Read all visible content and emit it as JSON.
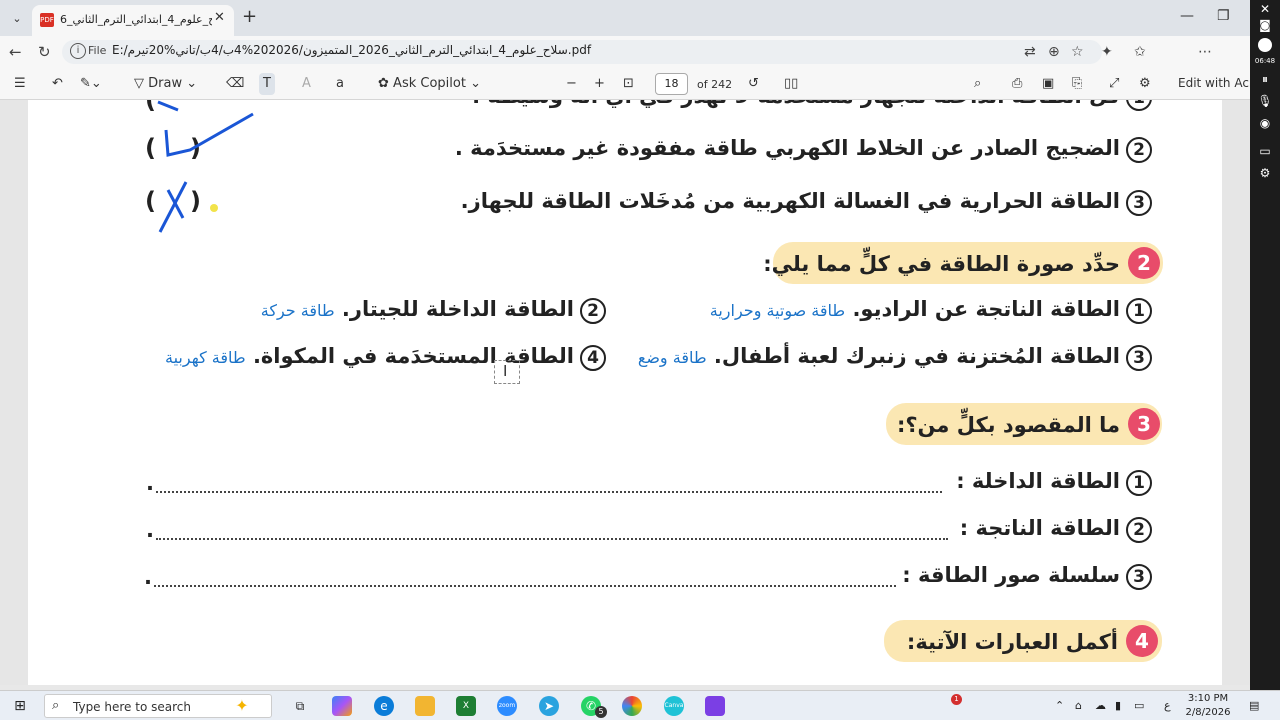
{
  "browser": {
    "tab_title": "6_سلاح_علوم_4_ابتدائي_الترم_الثاني*",
    "tab_icon": "PDF",
    "url_prefix": "File",
    "url": "E:/سلاح_علوم_4_ابتدائي_الترم_الثاني_2026_المتميزون/202026%4ب/4ب/تاني%20تيرم.pdf"
  },
  "pdf_toolbar": {
    "draw_label": "Draw",
    "ask_copilot_label": "Ask Copilot",
    "page_number": "18",
    "page_count": "of 242",
    "edit_label": "Edit with Acro"
  },
  "doc": {
    "q1_item1_partial": "كل الطاقة الداخلة للجهاز مستخدمة لا تهدر في أي آلة وسيطة .",
    "q1_item2": "الضجيج الصادر عن الخلاط الكهربي طاقة مفقودة غير مستخدَمة .",
    "q1_item3": "الطاقة الحرارية في الغسالة الكهربية من مُدخَلات الطاقة للجهاز.",
    "num1": "1",
    "num2": "2",
    "num3": "3",
    "num4": "4",
    "paren_open": "(",
    "paren_close": ")",
    "section2_badge": "2",
    "section2_title": "حدِّد صورة الطاقة في كلٍّ مما يلي:",
    "s2_item1": "الطاقة الناتجة عن الراديو.",
    "s2_item1_answer": "طاقة صوتية وحرارية",
    "s2_item2": "الطاقة الداخلة للجيتار.",
    "s2_item2_answer": "طاقة حركة",
    "s2_item3": "الطاقة المُختزنة في زنبرك لعبة أطفال.",
    "s2_item3_answer": "طاقة وضع",
    "s2_item4": "الطاقة المستخدَمة في المكواة.",
    "s2_item4_answer": "طاقة كهربية",
    "section3_badge": "3",
    "section3_title": "ما المقصود بكلٍّ من؟:",
    "s3_item1": "الطاقة الداخلة :",
    "s3_item2": "الطاقة الناتجة :",
    "s3_item3": "سلسلة صور الطاقة :",
    "dot_end": ".",
    "section4_badge": "4",
    "section4_title": "أكمل العبارات الآتية:"
  },
  "side_panel": {
    "clock": "06:48"
  },
  "taskbar": {
    "search_placeholder": "Type here to search",
    "whatsapp_badge": "5",
    "notify_badge": "1",
    "lang": "ع",
    "time": "3:10 PM",
    "date": "2/8/2026"
  },
  "colors": {
    "answer_blue": "#1b73c8",
    "header_bg": "#fbe7b3",
    "badge_pink": "#e84c6a",
    "ink_blue": "#1a56d6"
  }
}
